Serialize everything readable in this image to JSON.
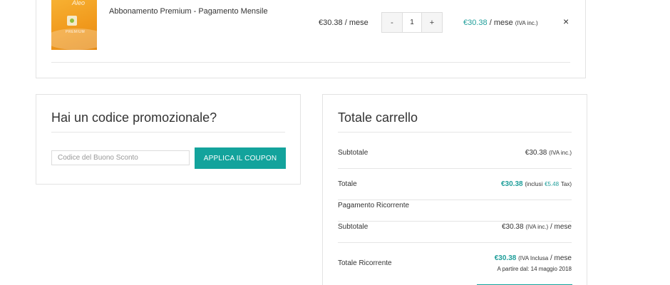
{
  "cart_item": {
    "image_brand": "Aleo",
    "image_label": "PREMIUM",
    "product_name": "Abbonamento Premium - Pagamento Mensile",
    "unit_price": "€30.38",
    "unit_price_suffix": "/ mese",
    "qty_minus": "-",
    "quantity": "1",
    "qty_plus": "+",
    "line_total": "€30.38",
    "line_total_suffix": "/ mese",
    "line_total_vat": "(IVA inc.)",
    "remove_symbol": "×"
  },
  "coupon": {
    "title": "Hai un codice promozionale?",
    "placeholder": "Codice del Buono Sconto",
    "value": "",
    "apply_label": "APPLICA IL COUPON"
  },
  "totals": {
    "title": "Totale carrello",
    "subtotal_label": "Subtotale",
    "subtotal_amount": "€30.38",
    "subtotal_vat": "(IVA inc.)",
    "total_label": "Totale",
    "total_amount": "€30.38",
    "total_incl_prefix": "(inclusi",
    "total_tax_amount": "€5.48",
    "total_tax_suffix": "Tax)",
    "recurring_header": "Pagamento Ricorrente",
    "recurring_subtotal_label": "Subtotale",
    "recurring_subtotal_amount": "€30.38",
    "recurring_subtotal_vat": "(IVA inc.)",
    "recurring_subtotal_period": "/ mese",
    "recurring_total_label": "Totale Ricorrente",
    "recurring_total_amount": "€30.38",
    "recurring_total_vat": "(IVA Inclusa",
    "recurring_total_period": "/ mese",
    "recurring_start": "A partire dal: 14 maggio 2018"
  },
  "colors": {
    "accent": "#13a39c",
    "price_teal": "#1f9e9a",
    "border": "#e3e3e3",
    "text": "#333333"
  }
}
